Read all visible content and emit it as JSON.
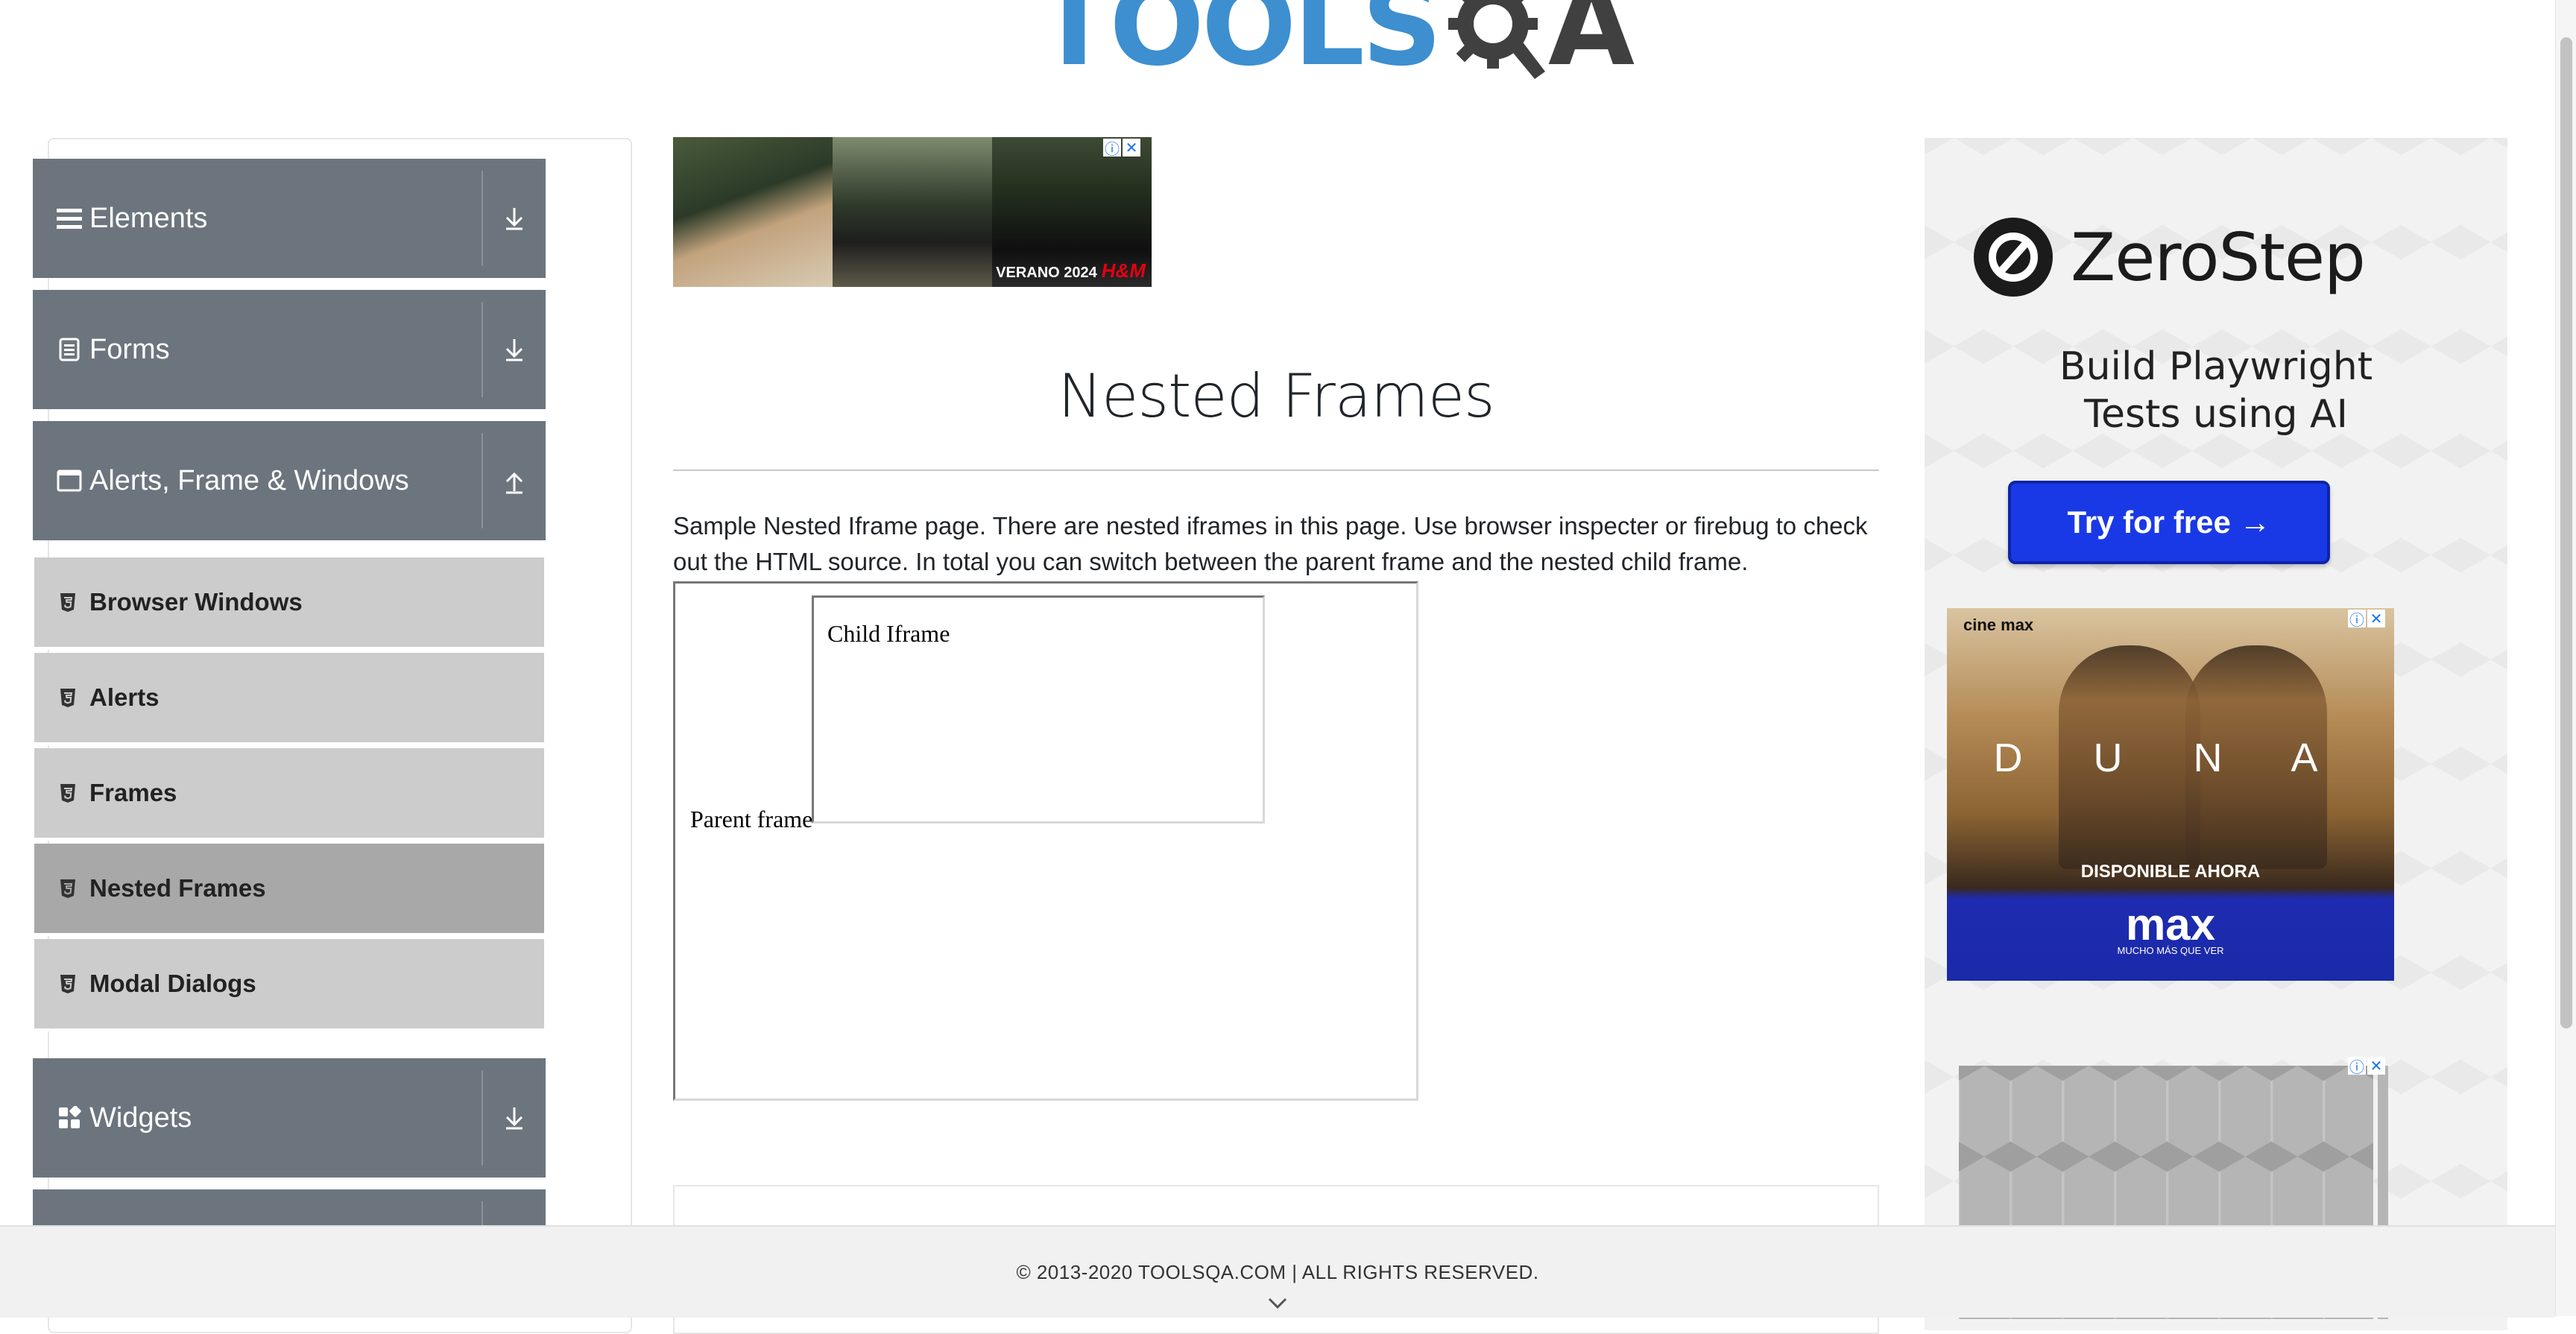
{
  "header": {
    "logo_text_left": "TOOLS",
    "logo_text_right": "A"
  },
  "sidebar": {
    "groups": [
      {
        "label": "Elements",
        "icon": "hamburger-icon",
        "expanded": false
      },
      {
        "label": "Forms",
        "icon": "document-icon",
        "expanded": false
      },
      {
        "label": "Alerts, Frame & Windows",
        "icon": "window-icon",
        "expanded": true
      },
      {
        "label": "Widgets",
        "icon": "widgets-icon",
        "expanded": false
      }
    ],
    "items": [
      {
        "label": "Browser Windows",
        "active": false
      },
      {
        "label": "Alerts",
        "active": false
      },
      {
        "label": "Frames",
        "active": false
      },
      {
        "label": "Nested Frames",
        "active": true
      },
      {
        "label": "Modal Dialogs",
        "active": false
      }
    ]
  },
  "main": {
    "banner_ad": {
      "tag": "VERANO 2024",
      "brand": "H&M"
    },
    "title": "Nested Frames",
    "description": "Sample Nested Iframe page. There are nested iframes in this page. Use browser inspecter or firebug to check out the HTML source. In total you can switch between the parent frame and the nested child frame.",
    "parent_frame_text": "Parent frame",
    "child_frame_text": "Child Iframe"
  },
  "ads": {
    "zerostep": {
      "brand": "ZeroStep",
      "tagline": "Build Playwright Tests using AI",
      "cta": "Try for free →"
    },
    "dune": {
      "top_tag": "cine max",
      "title": "D U N A",
      "availability": "DISPONIBLE AHORA",
      "network": "max",
      "slogan": "MUCHO MÁS QUE VER"
    }
  },
  "footer": {
    "copyright": "© 2013-2020 TOOLSQA.COM | ALL RIGHTS RESERVED."
  },
  "colors": {
    "sidebar_group": "#6c757d",
    "sidebar_item": "#cccccc",
    "sidebar_item_active": "#a8a8a8",
    "logo_blue": "#3d8fd0",
    "cta_blue": "#1a39e6"
  }
}
